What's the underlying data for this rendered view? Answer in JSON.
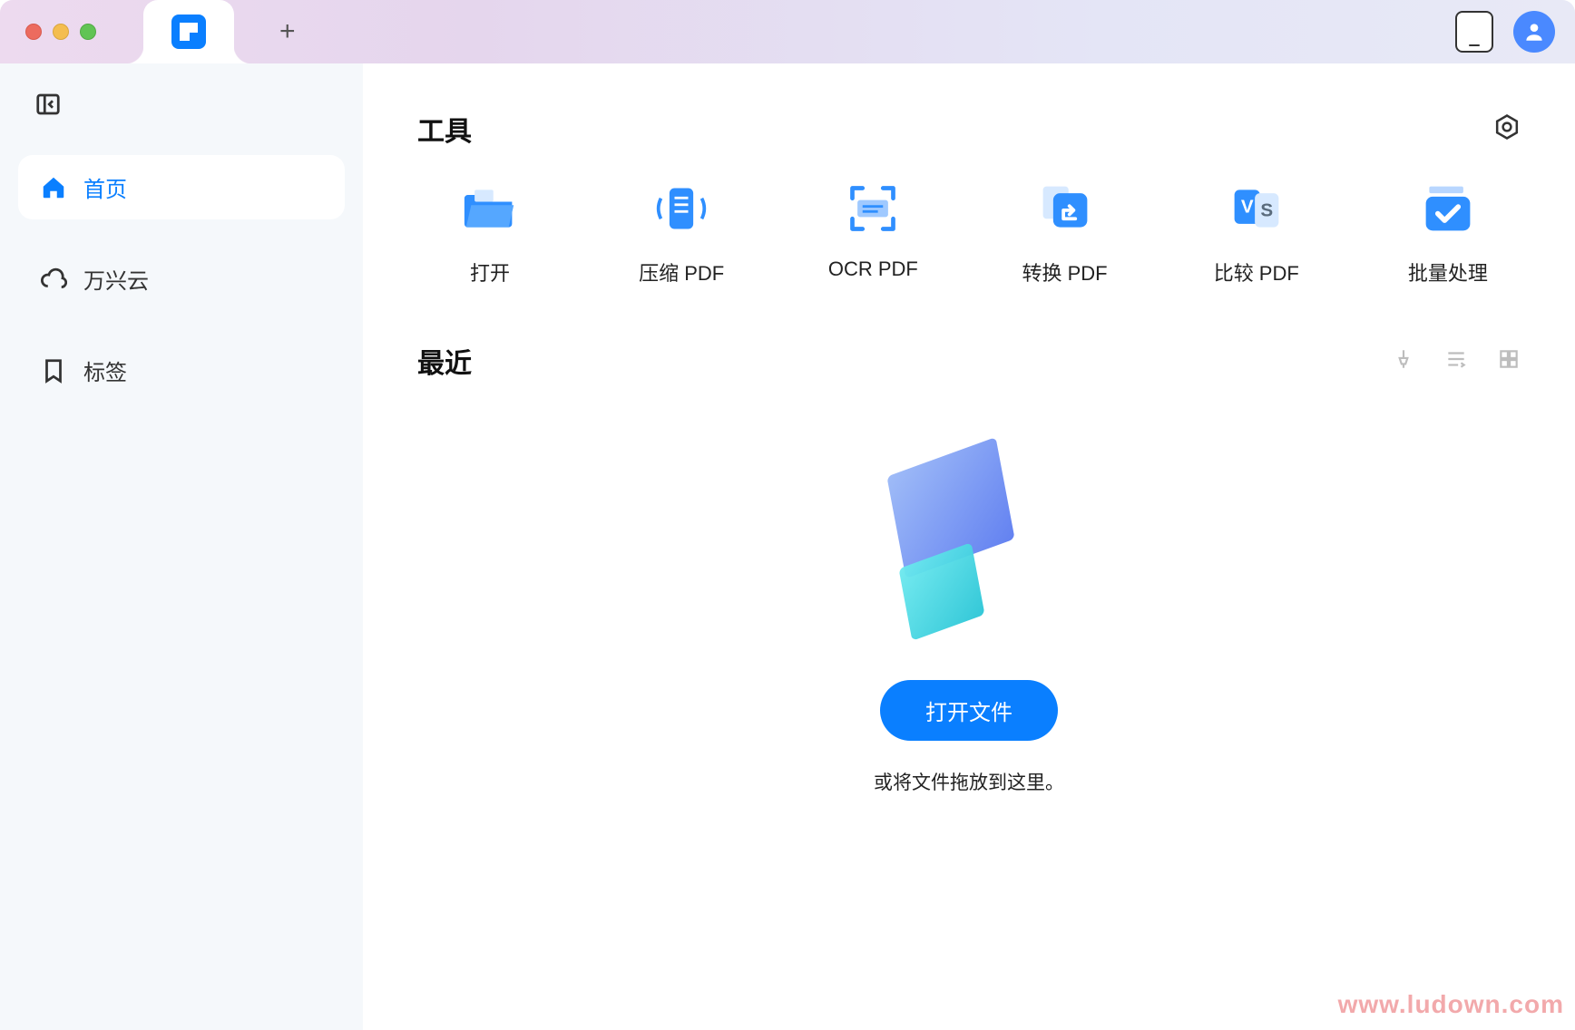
{
  "titlebar": {
    "new_tab_tooltip": "+",
    "mobile_button": "mobile"
  },
  "sidebar": {
    "items": [
      {
        "label": "首页",
        "icon": "home"
      },
      {
        "label": "万兴云",
        "icon": "cloud"
      },
      {
        "label": "标签",
        "icon": "bookmark"
      }
    ]
  },
  "tools": {
    "title": "工具",
    "items": [
      {
        "label": "打开",
        "icon": "folder"
      },
      {
        "label": "压缩 PDF",
        "icon": "compress"
      },
      {
        "label": "OCR PDF",
        "icon": "ocr"
      },
      {
        "label": "转换 PDF",
        "icon": "convert"
      },
      {
        "label": "比较 PDF",
        "icon": "compare"
      },
      {
        "label": "批量处理",
        "icon": "batch"
      }
    ]
  },
  "recent": {
    "title": "最近",
    "open_button": "打开文件",
    "drop_hint": "或将文件拖放到这里。"
  },
  "watermark": "www.ludown.com"
}
